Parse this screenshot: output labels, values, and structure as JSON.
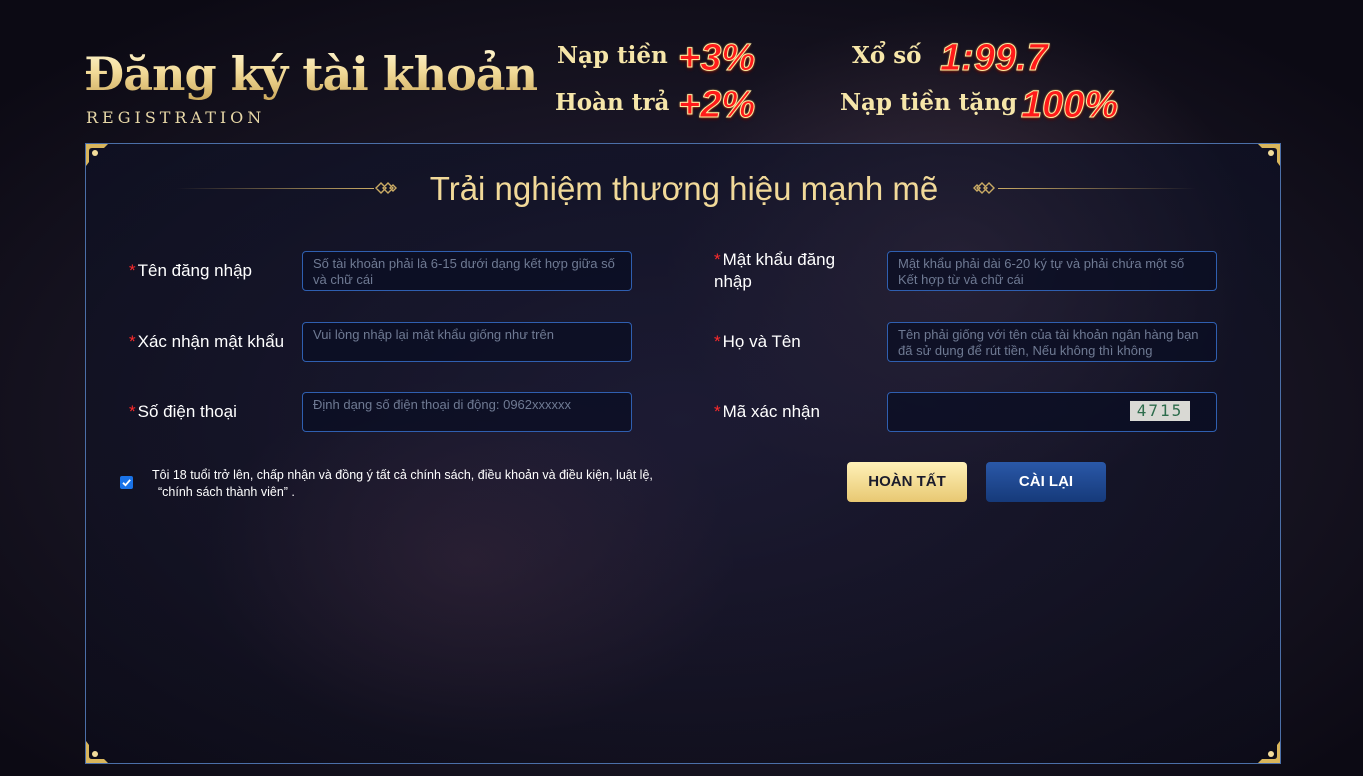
{
  "header": {
    "title": "Đăng ký tài khoản",
    "subtitle": "REGISTRATION"
  },
  "promos": [
    {
      "label": "Nạp tiền",
      "value": "+3%"
    },
    {
      "label": "Hoàn trả",
      "value": "+2%"
    },
    {
      "label": "Xổ số",
      "value": "1:99.7"
    },
    {
      "label": "Nạp tiền tặng",
      "value": "100%"
    }
  ],
  "panel": {
    "heading": "Trải nghiệm thương hiệu mạnh mẽ"
  },
  "form": {
    "required_mark": "*",
    "username": {
      "label": "Tên đăng nhập",
      "placeholder": "Số tài khoản phải là 6-15 dưới dạng kết hợp giữa số và chữ cái"
    },
    "password": {
      "label": "Mật khẩu đăng nhập",
      "placeholder": "Mật khẩu phải dài 6-20 ký tự và phải chứa một số Kết hợp từ và chữ cái"
    },
    "confirm_password": {
      "label": "Xác nhận mật khẩu",
      "placeholder": "Vui lòng nhập lại mật khẩu giống như trên"
    },
    "full_name": {
      "label": "Họ và Tên",
      "placeholder": "Tên phải giống với tên của tài khoản ngân hàng bạn đã sử dụng để rút tiền, Nếu không thì không"
    },
    "phone": {
      "label": "Số điện thoại",
      "placeholder": "Định dạng số điện thoại di động: 0962xxxxxx"
    },
    "captcha": {
      "label": "Mã xác nhận",
      "value": "",
      "code": "4715"
    },
    "agreement": {
      "checked": true,
      "line1": "Tôi 18 tuổi trở lên, chấp nhận và đồng ý tất cả chính sách, điều khoản và điều kiện, luật lệ,",
      "line2": "“chính sách thành viên” ."
    },
    "submit_label": "HOÀN TẤT",
    "reset_label": "CÀI LẠI"
  },
  "colors": {
    "gold": "#f1d999",
    "required": "#ff2b2b",
    "promo_value": "#ff1a1a",
    "input_border": "#2f5fb0",
    "reset_button": "#1e4a92",
    "submit_button": "#f2d98a"
  }
}
